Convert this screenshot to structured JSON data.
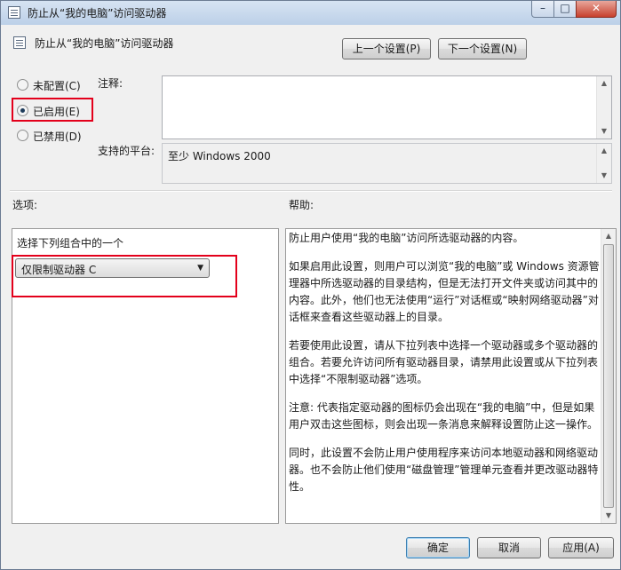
{
  "window": {
    "title": "防止从“我的电脑”访问驱动器",
    "controls": {
      "minimize": "–",
      "maximize": "□",
      "close": "✕"
    }
  },
  "header": {
    "title": "防止从“我的电脑”访问驱动器",
    "prev_button": "上一个设置(P)",
    "next_button": "下一个设置(N)"
  },
  "state": {
    "options": [
      {
        "label": "未配置(C)",
        "checked": false
      },
      {
        "label": "已启用(E)",
        "checked": true
      },
      {
        "label": "已禁用(D)",
        "checked": false
      }
    ]
  },
  "comment": {
    "label": "注释:",
    "value": ""
  },
  "platform": {
    "label": "支持的平台:",
    "value": "至少 Windows 2000"
  },
  "options_section": {
    "label": "选项:",
    "combo_label": "选择下列组合中的一个",
    "combo_value": "仅限制驱动器 C"
  },
  "help_section": {
    "label": "帮助:",
    "paragraphs": [
      "防止用户使用“我的电脑”访问所选驱动器的内容。",
      "如果启用此设置，则用户可以浏览“我的电脑”或 Windows 资源管理器中所选驱动器的目录结构，但是无法打开文件夹或访问其中的内容。此外，他们也无法使用“运行”对话框或“映射网络驱动器”对话框来查看这些驱动器上的目录。",
      "若要使用此设置，请从下拉列表中选择一个驱动器或多个驱动器的组合。若要允许访问所有驱动器目录，请禁用此设置或从下拉列表中选择“不限制驱动器”选项。",
      "注意: 代表指定驱动器的图标仍会出现在“我的电脑”中，但是如果用户双击这些图标，则会出现一条消息来解释设置防止这一操作。",
      "同时，此设置不会防止用户使用程序来访问本地驱动器和网络驱动器。也不会防止他们使用“磁盘管理”管理单元查看并更改驱动器特性。"
    ]
  },
  "footer": {
    "ok_button": "确定",
    "cancel_button": "取消",
    "apply_button": "应用(A)"
  }
}
